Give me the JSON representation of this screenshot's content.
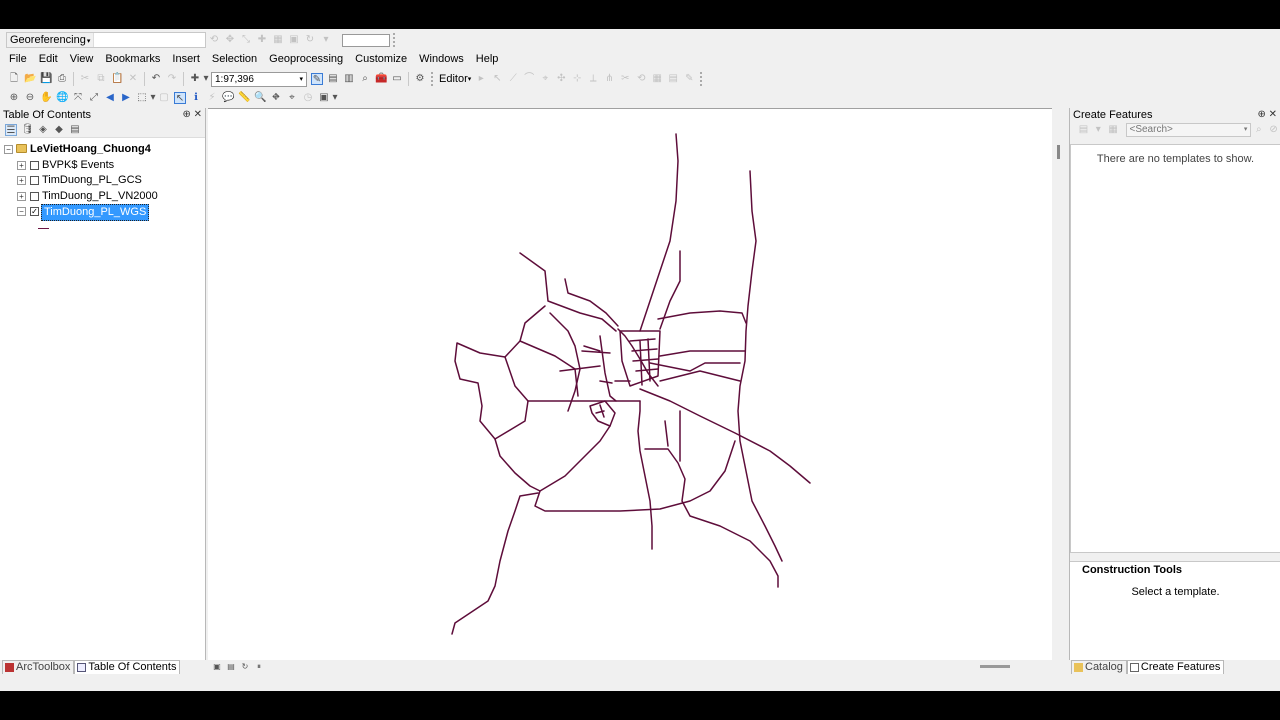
{
  "app": {
    "georef_toolbar": {
      "label": "Georeferencing"
    },
    "menu": [
      "File",
      "Edit",
      "View",
      "Bookmarks",
      "Insert",
      "Selection",
      "Geoprocessing",
      "Customize",
      "Windows",
      "Help"
    ],
    "scale": "1:97,396",
    "editor_label": "Editor"
  },
  "toc": {
    "title": "Table Of Contents",
    "root": "LeVietHoang_Chuong4",
    "layers": [
      {
        "name": "BVPK$ Events",
        "checked": false
      },
      {
        "name": "TimDuong_PL_GCS",
        "checked": false
      },
      {
        "name": "TimDuong_PL_VN2000",
        "checked": false
      },
      {
        "name": "TimDuong_PL_WGS",
        "checked": true,
        "selected": true
      }
    ]
  },
  "create_features": {
    "title": "Create Features",
    "search_placeholder": "<Search>",
    "empty_message": "There are no templates to show.",
    "construction_title": "Construction Tools",
    "construction_message": "Select a template."
  },
  "bottom_tabs_left": [
    "ArcToolbox",
    "Table Of Contents"
  ],
  "bottom_tabs_right": [
    "Catalog",
    "Create Features"
  ],
  "colors": {
    "road": "#5e0d3a",
    "selection": "#3399ff"
  }
}
